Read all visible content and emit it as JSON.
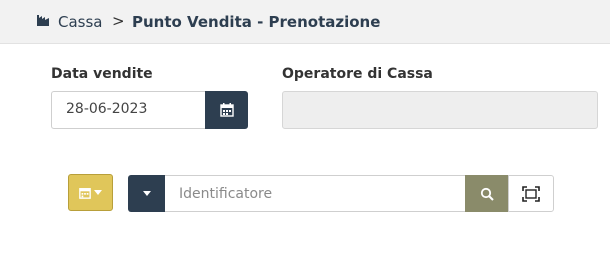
{
  "breadcrumb": {
    "root": "Cassa",
    "separator": ">",
    "current": "Punto Vendita - Prenotazione"
  },
  "form": {
    "date_label": "Data vendite",
    "date_value": "28-06-2023",
    "operator_label": "Operatore di Cassa",
    "operator_value": ""
  },
  "search": {
    "placeholder": "Identificatore",
    "value": ""
  },
  "icons": {
    "home": "home-icon",
    "date_picker": "calendar-icon",
    "calendar_dropdown": "calendar-icon",
    "type_dropdown": "caret-down-icon",
    "search": "search-icon",
    "scan": "barcode-scan-icon"
  },
  "colors": {
    "primary_dark": "#2d3e50",
    "accent_yellow": "#e0c65a",
    "search_olive": "#8a8b6a",
    "disabled_field": "#eeeeee"
  }
}
